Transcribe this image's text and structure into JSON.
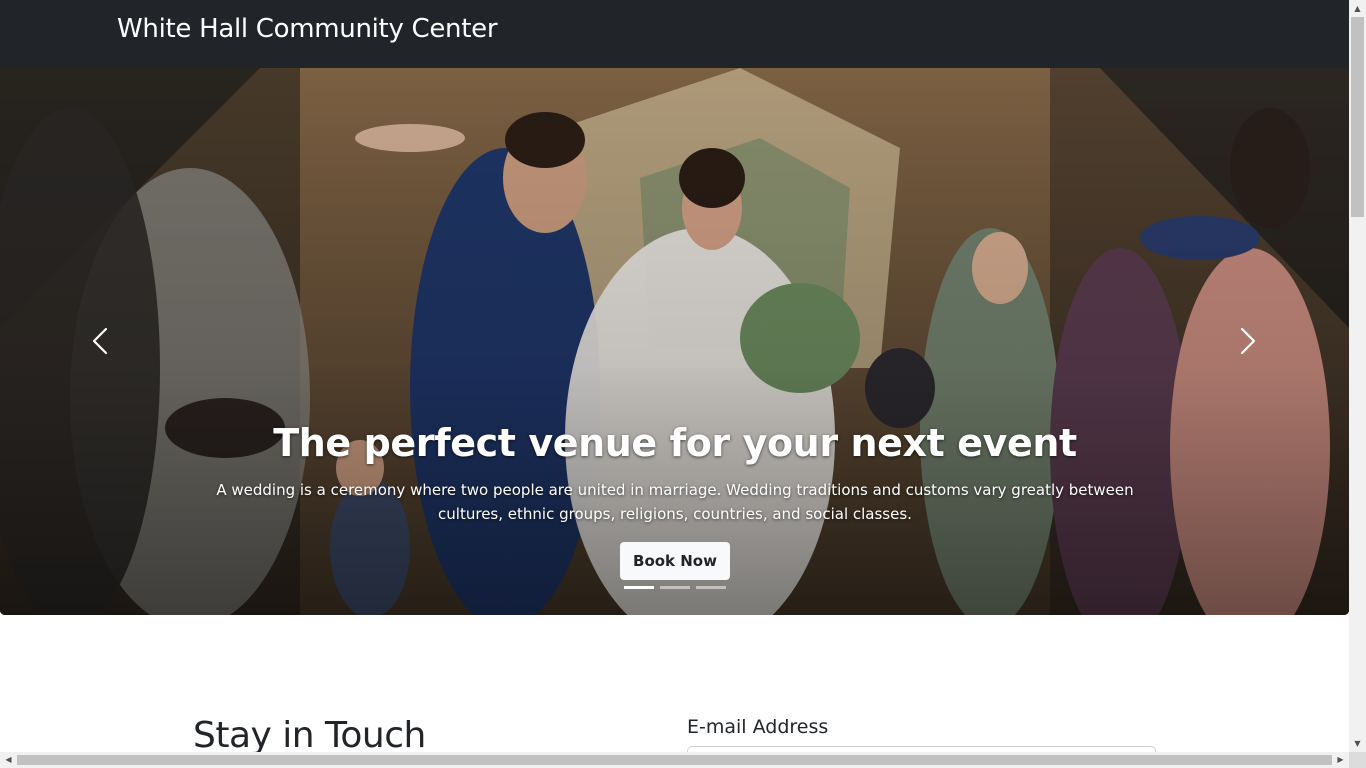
{
  "navbar": {
    "brand": "White Hall Community Center"
  },
  "carousel": {
    "title": "The perfect venue for your next event",
    "text": "A wedding is a ceremony where two people are united in marriage. Wedding traditions and customs vary greatly between cultures, ethnic groups, religions, countries, and social classes.",
    "button_label": "Book Now",
    "slide_count": 3,
    "active_slide": 1,
    "prev_icon": "chevron-left-icon",
    "next_icon": "chevron-right-icon"
  },
  "newsletter": {
    "heading": "Stay in Touch",
    "email_label": "E-mail Address",
    "email_value": ""
  },
  "colors": {
    "navbar_bg": "#212529",
    "button_bg": "#f8f9fa",
    "text_light": "#ffffff"
  }
}
